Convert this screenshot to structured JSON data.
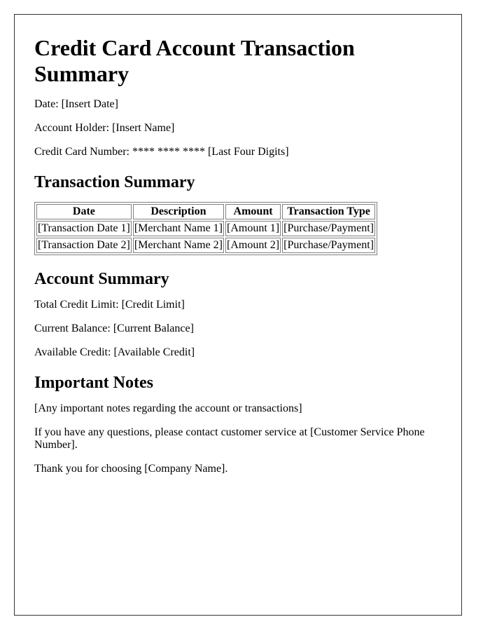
{
  "document": {
    "title": "Credit Card Account Transaction Summary",
    "date_line": "Date: [Insert Date]",
    "account_holder_line": "Account Holder: [Insert Name]",
    "card_number_line": "Credit Card Number: **** **** **** [Last Four Digits]"
  },
  "transactions": {
    "heading": "Transaction Summary",
    "columns": [
      "Date",
      "Description",
      "Amount",
      "Transaction Type"
    ],
    "rows": [
      [
        "[Transaction Date 1]",
        "[Merchant Name 1]",
        "[Amount 1]",
        "[Purchase/Payment]"
      ],
      [
        "[Transaction Date 2]",
        "[Merchant Name 2]",
        "[Amount 2]",
        "[Purchase/Payment]"
      ]
    ]
  },
  "account_summary": {
    "heading": "Account Summary",
    "total_credit_limit": "Total Credit Limit: [Credit Limit]",
    "current_balance": "Current Balance: [Current Balance]",
    "available_credit": "Available Credit: [Available Credit]"
  },
  "notes": {
    "heading": "Important Notes",
    "note": "[Any important notes regarding the account or transactions]",
    "contact": "If you have any questions, please contact customer service at [Customer Service Phone Number].",
    "thanks": "Thank you for choosing [Company Name]."
  }
}
